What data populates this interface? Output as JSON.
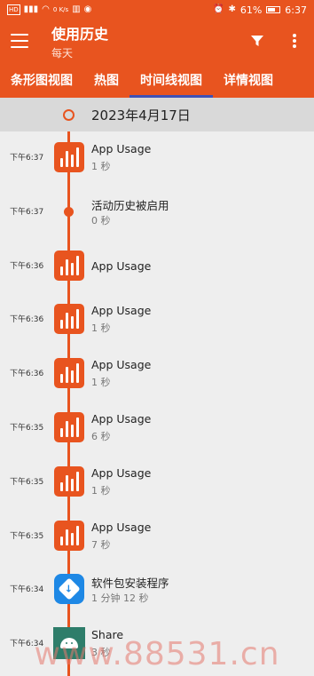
{
  "status_bar": {
    "left_icons": [
      "hd-icon",
      "signal-icon",
      "wifi-icon",
      "data-speed-icon",
      "app-icon",
      "shield-icon"
    ],
    "data_speed": "0 K/s",
    "battery": "61%",
    "time": "6:37"
  },
  "toolbar": {
    "title": "使用历史",
    "subtitle": "每天"
  },
  "tabs": [
    {
      "label": "条形图视图"
    },
    {
      "label": "热图"
    },
    {
      "label": "时间线视图",
      "active": true
    },
    {
      "label": "详情视图"
    }
  ],
  "timeline": {
    "date": "2023年4月17日",
    "entries": [
      {
        "time": "下午6:37",
        "name": "App Usage",
        "duration": "1 秒",
        "icon": "app-usage-icon"
      },
      {
        "time": "下午6:37",
        "name": "活动历史被启用",
        "duration": "0 秒",
        "icon": "dot"
      },
      {
        "time": "下午6:36",
        "name": "App Usage",
        "duration": "",
        "icon": "app-usage-icon"
      },
      {
        "time": "下午6:36",
        "name": "App Usage",
        "duration": "1 秒",
        "icon": "app-usage-icon"
      },
      {
        "time": "下午6:36",
        "name": "App Usage",
        "duration": "1 秒",
        "icon": "app-usage-icon"
      },
      {
        "time": "下午6:35",
        "name": "App Usage",
        "duration": "6 秒",
        "icon": "app-usage-icon"
      },
      {
        "time": "下午6:35",
        "name": "App Usage",
        "duration": "1 秒",
        "icon": "app-usage-icon"
      },
      {
        "time": "下午6:35",
        "name": "App Usage",
        "duration": "7 秒",
        "icon": "app-usage-icon"
      },
      {
        "time": "下午6:34",
        "name": "软件包安装程序",
        "duration": "1 分钟 12 秒",
        "icon": "package-installer-icon"
      },
      {
        "time": "下午6:34",
        "name": "Share",
        "duration": "3 秒",
        "icon": "share-icon"
      }
    ]
  },
  "colors": {
    "accent": "#e8541f",
    "tab_indicator": "#3f51b5",
    "background": "#eeeeee",
    "date_header": "#d9d9d9"
  },
  "watermark": "www.88531.cn"
}
